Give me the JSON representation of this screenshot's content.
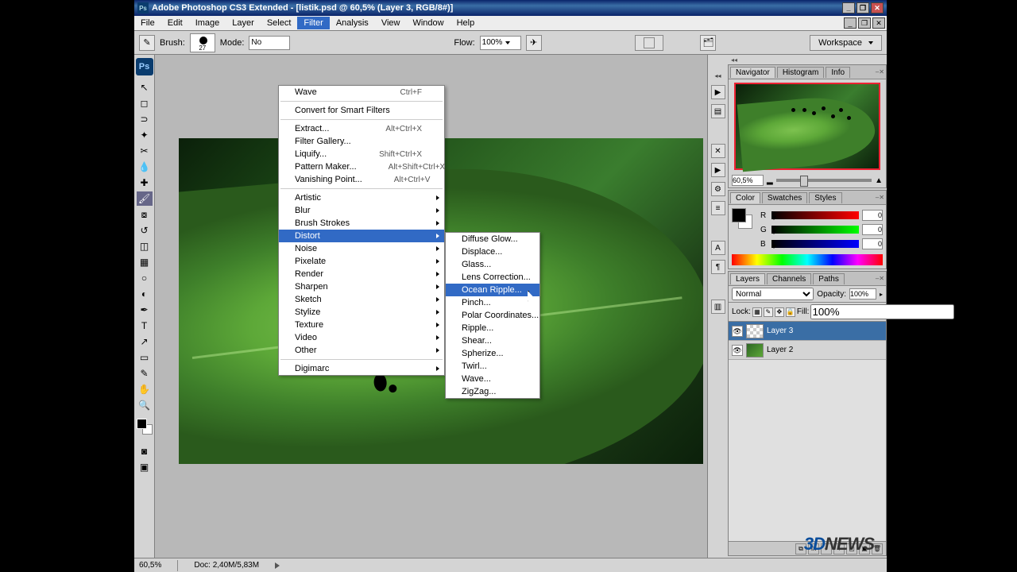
{
  "title": "Adobe Photoshop CS3 Extended - [listik.psd @ 60,5% (Layer 3, RGB/8#)]",
  "menu": {
    "items": [
      "File",
      "Edit",
      "Image",
      "Layer",
      "Select",
      "Filter",
      "Analysis",
      "View",
      "Window",
      "Help"
    ],
    "open_index": 5
  },
  "optbar": {
    "brush_label": "Brush:",
    "brush_size": "27",
    "mode_label": "Mode:",
    "mode_value": "No",
    "flow_label": "Flow:",
    "flow_value": "100%",
    "workspace": "Workspace"
  },
  "filter_menu": {
    "top": {
      "label": "Wave",
      "shortcut": "Ctrl+F"
    },
    "convert": "Convert for Smart Filters",
    "group1": [
      {
        "label": "Extract...",
        "shortcut": "Alt+Ctrl+X"
      },
      {
        "label": "Filter Gallery...",
        "shortcut": ""
      },
      {
        "label": "Liquify...",
        "shortcut": "Shift+Ctrl+X"
      },
      {
        "label": "Pattern Maker...",
        "shortcut": "Alt+Shift+Ctrl+X"
      },
      {
        "label": "Vanishing Point...",
        "shortcut": "Alt+Ctrl+V"
      }
    ],
    "categories": [
      "Artistic",
      "Blur",
      "Brush Strokes",
      "Distort",
      "Noise",
      "Pixelate",
      "Render",
      "Sharpen",
      "Sketch",
      "Stylize",
      "Texture",
      "Video",
      "Other"
    ],
    "categories_highlight": "Distort",
    "last": "Digimarc"
  },
  "distort_menu": {
    "items": [
      "Diffuse Glow...",
      "Displace...",
      "Glass...",
      "Lens Correction...",
      "Ocean Ripple...",
      "Pinch...",
      "Polar Coordinates...",
      "Ripple...",
      "Shear...",
      "Spherize...",
      "Twirl...",
      "Wave...",
      "ZigZag..."
    ],
    "highlight": "Ocean Ripple..."
  },
  "navigator": {
    "tabs": [
      "Navigator",
      "Histogram",
      "Info"
    ],
    "zoom": "60,5%"
  },
  "color": {
    "tabs": [
      "Color",
      "Swatches",
      "Styles"
    ],
    "r_label": "R",
    "g_label": "G",
    "b_label": "B",
    "r": "0",
    "g": "0",
    "b": "0"
  },
  "layers": {
    "tabs": [
      "Layers",
      "Channels",
      "Paths"
    ],
    "blend_mode": "Normal",
    "opacity_label": "Opacity:",
    "opacity": "100%",
    "lock_label": "Lock:",
    "fill_label": "Fill:",
    "fill": "100%",
    "items": [
      {
        "name": "Layer 3",
        "selected": true,
        "thumb": "checker"
      },
      {
        "name": "Layer 2",
        "selected": false,
        "thumb": "green"
      }
    ]
  },
  "status": {
    "zoom": "60,5%",
    "doc": "Doc: 2,40M/5,83M"
  },
  "watermark": {
    "a": "3D",
    "b": "NEWS"
  }
}
